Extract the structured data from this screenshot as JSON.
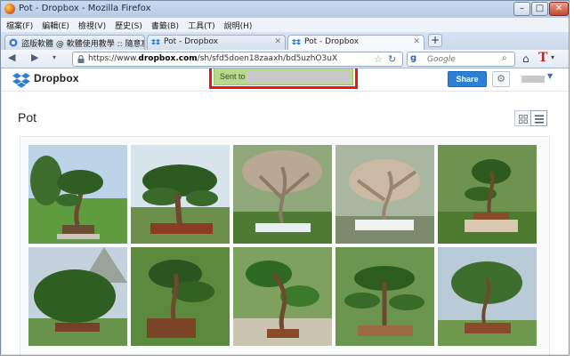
{
  "window": {
    "title": "Pot - Dropbox - Mozilla Firefox"
  },
  "menu": [
    "檔案(F)",
    "編輯(E)",
    "檢視(V)",
    "歷史(S)",
    "書籤(B)",
    "工具(T)",
    "說明(H)"
  ],
  "tabs": [
    {
      "label": "盜版軟體 @ 軟體使用教學 :: 隨意窩 X...",
      "active": false
    },
    {
      "label": "Pot - Dropbox",
      "active": false
    },
    {
      "label": "Pot - Dropbox",
      "active": true
    }
  ],
  "nav": {
    "url_prefix": "https://www.",
    "url_domain": "dropbox.com",
    "url_path": "/sh/sfd5doen18zaaxh/bd5uzhO3uX",
    "search_placeholder": "Google"
  },
  "dropbox": {
    "brand": "Dropbox",
    "sent_to_label": "Sent to",
    "share_label": "Share",
    "folder_title": "Pot"
  },
  "colors": {
    "share_blue": "#2b7fd6",
    "sent_green": "#b8d98b",
    "highlight_red": "#ea1515"
  },
  "photos": [
    {
      "alt": "bonsai-photo"
    },
    {
      "alt": "bonsai-photo"
    },
    {
      "alt": "bonsai-photo"
    },
    {
      "alt": "bonsai-photo"
    },
    {
      "alt": "bonsai-photo"
    },
    {
      "alt": "bonsai-photo"
    },
    {
      "alt": "bonsai-photo"
    },
    {
      "alt": "bonsai-photo"
    },
    {
      "alt": "bonsai-photo"
    },
    {
      "alt": "bonsai-photo"
    }
  ]
}
